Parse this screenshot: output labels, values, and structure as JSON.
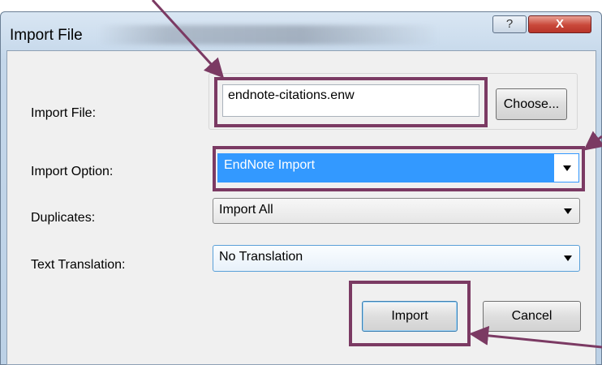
{
  "window": {
    "title": "Import File",
    "help_glyph": "?",
    "close_glyph": "X"
  },
  "form": {
    "import_file_label": "Import File:",
    "import_file_value": "endnote-citations.enw",
    "choose_label": "Choose...",
    "import_option_label": "Import Option:",
    "import_option_value": "EndNote Import",
    "duplicates_label": "Duplicates:",
    "duplicates_value": "Import All",
    "text_translation_label": "Text Translation:",
    "text_translation_value": "No Translation"
  },
  "buttons": {
    "import_label": "Import",
    "cancel_label": "Cancel"
  },
  "annotation": {
    "highlight_color": "#7b3a63"
  }
}
